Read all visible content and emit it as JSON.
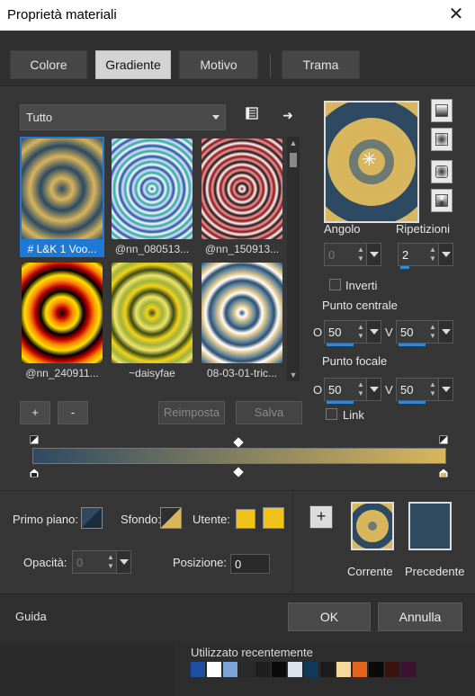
{
  "window": {
    "title": "Proprietà materiali",
    "close_symbol": "✕"
  },
  "tabs": [
    {
      "label": "Colore",
      "active": false
    },
    {
      "label": "Gradiente",
      "active": true
    },
    {
      "label": "Motivo",
      "active": false
    },
    {
      "label": "Trama",
      "active": false
    }
  ],
  "category": {
    "selected": "Tutto"
  },
  "icons": {
    "library": "library-icon",
    "next": "arrow-right-icon",
    "center": "crosshair-icon"
  },
  "gradients": [
    {
      "label": "# L&K 1 Voo...",
      "colors": [
        "#2c4a63",
        "#d8b45b"
      ],
      "rings": 3,
      "selected": true
    },
    {
      "label": "@nn_080513...",
      "colors": [
        "#1c4f9e",
        "#ffffff",
        "#2aa7a0",
        "#e0e0ff"
      ],
      "rings": 6,
      "selected": false
    },
    {
      "label": "@nn_150913...",
      "colors": [
        "#8c0f12",
        "#ffffff",
        "#2a0a0a",
        "#e59b9b"
      ],
      "rings": 6,
      "selected": false
    },
    {
      "label": "@nn_240911...",
      "colors": [
        "#000000",
        "#c00000",
        "#ff8a00",
        "#ffe000"
      ],
      "rings": 3,
      "selected": false
    },
    {
      "label": "~daisyfae",
      "colors": [
        "#3b4a12",
        "#f1d21c",
        "#9fb23a",
        "#efe36a"
      ],
      "rings": 3,
      "selected": false
    },
    {
      "label": "08-03-01-tric...",
      "colors": [
        "#2f4e68",
        "#ffffff",
        "#d8bd80",
        "#6a8fa8"
      ],
      "rings": 4,
      "selected": false
    }
  ],
  "list_buttons": {
    "add": "+",
    "remove": "-",
    "reset": "Reimposta",
    "save": "Salva"
  },
  "properties": {
    "angle_label": "Angolo",
    "angle": "0",
    "repeats_label": "Ripetizioni",
    "repeats": "2",
    "invert_label": "Inverti",
    "center_label": "Punto centrale",
    "center_h": "50",
    "center_v": "50",
    "focal_label": "Punto focale",
    "focal_h": "50",
    "focal_v": "50",
    "h_prefix": "O",
    "v_prefix": "V",
    "link_label": "Link"
  },
  "editor": {
    "start_color": "#2e4a63",
    "end_color": "#d9b65c"
  },
  "bottom": {
    "foreground_label": "Primo piano:",
    "background_label": "Sfondo:",
    "user_label": "Utente:",
    "user_color": "#f2c21a",
    "opacity_label": "Opacità:",
    "opacity": "0",
    "position_label": "Posizione:",
    "position": "0",
    "add_symbol": "+",
    "current_label": "Corrente",
    "previous_label": "Precedente",
    "previous_color": "#2f4a5e"
  },
  "footer": {
    "help": "Guida",
    "ok": "OK",
    "cancel": "Annulla"
  },
  "recent": {
    "label": "Utilizzato recentemente",
    "colors": [
      "#1d4fa3",
      "#ffffff",
      "#7aa3d6",
      "#2a2a2a",
      "#1f1f1f",
      "#0a0a0a",
      "#dde3ea",
      "#0f3a5e",
      "#1c1c1c",
      "#f6d89a",
      "#e3631c",
      "#0a0a0a",
      "#3a140c",
      "#3c1030"
    ]
  }
}
